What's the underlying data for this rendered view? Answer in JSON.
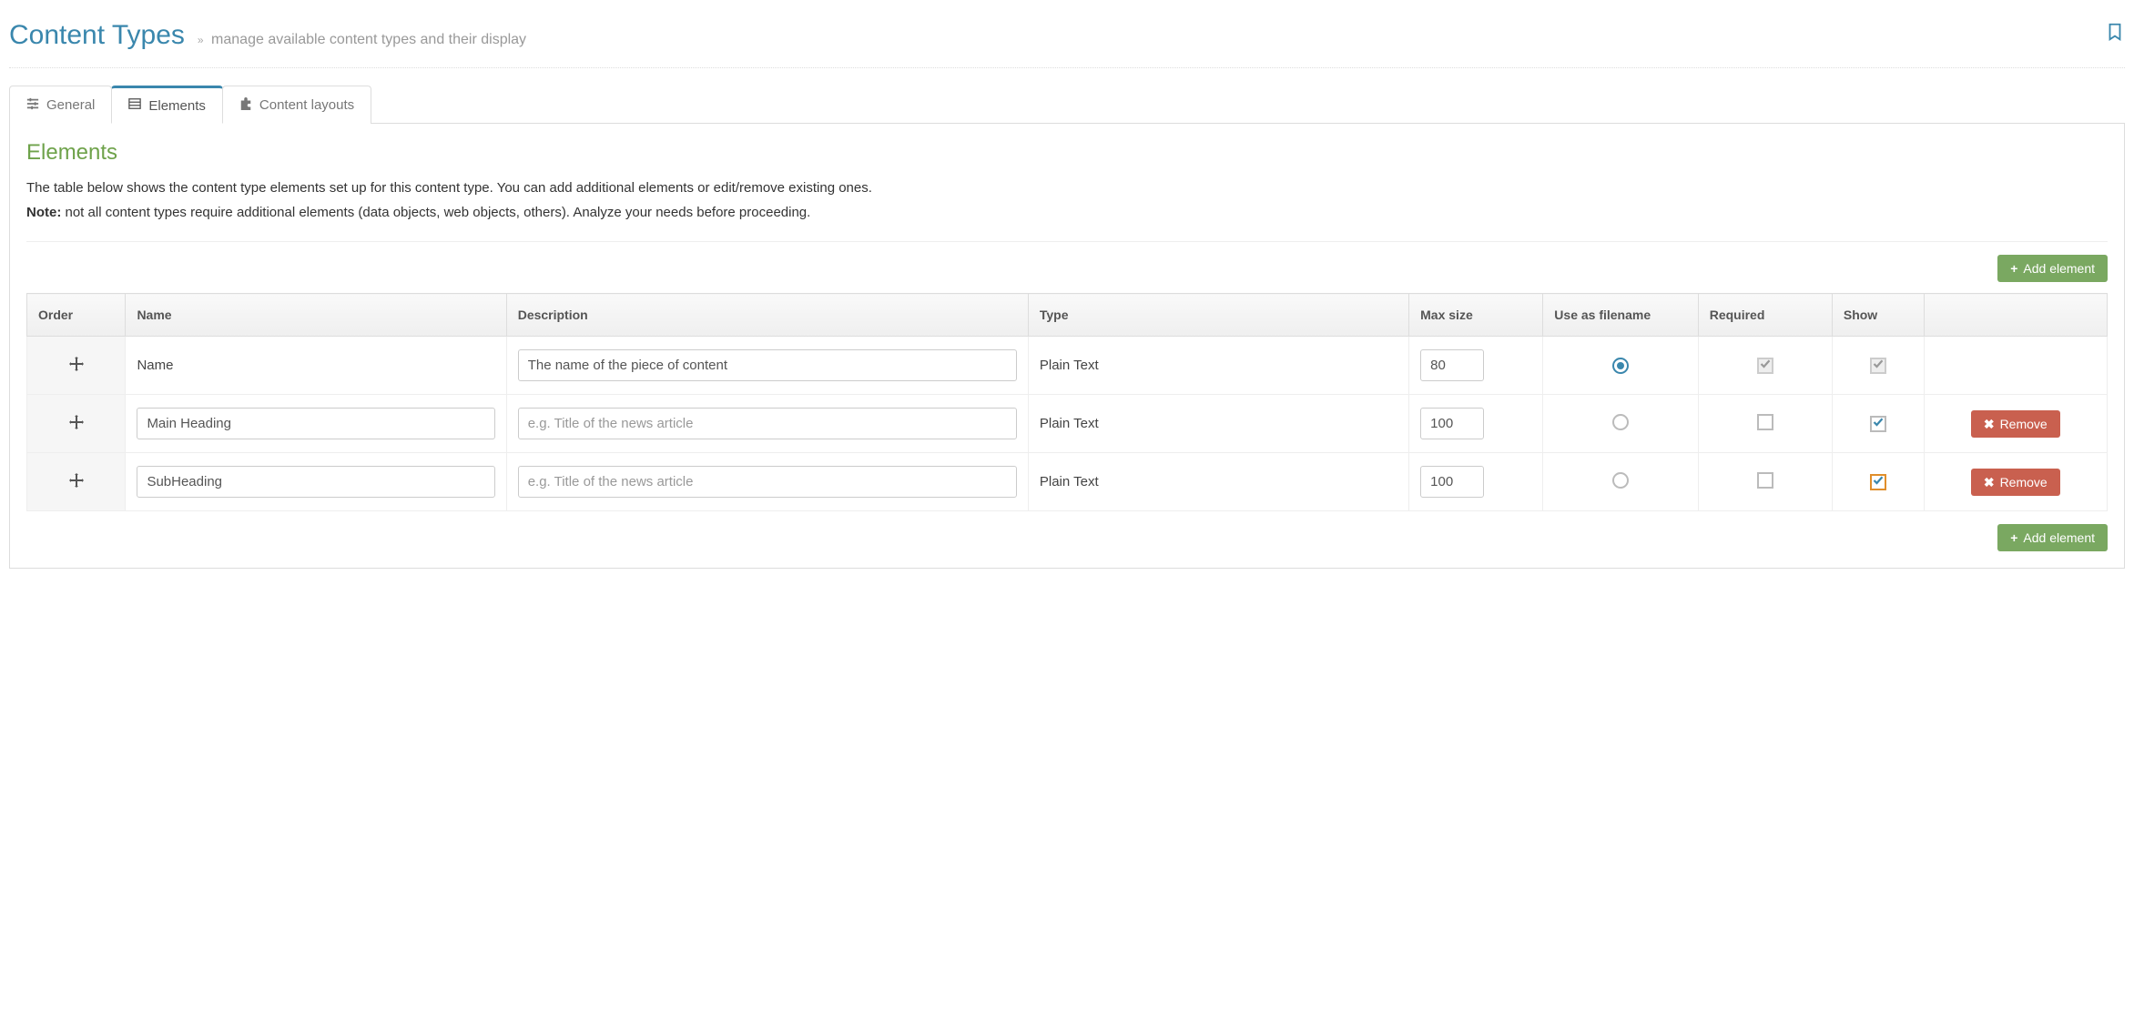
{
  "header": {
    "title": "Content Types",
    "subtitle": "manage available content types and their display"
  },
  "tabs": [
    {
      "label": "General",
      "active": false
    },
    {
      "label": "Elements",
      "active": true
    },
    {
      "label": "Content layouts",
      "active": false
    }
  ],
  "section": {
    "title": "Elements",
    "intro_line1": "The table below shows the content type elements set up for this content type. You can add additional elements or edit/remove existing ones.",
    "note_label": "Note:",
    "intro_line2": " not all content types require additional elements (data objects, web objects, others). Analyze your needs before proceeding."
  },
  "buttons": {
    "add_element": "Add element",
    "remove": "Remove"
  },
  "table": {
    "headers": {
      "order": "Order",
      "name": "Name",
      "description": "Description",
      "type": "Type",
      "max_size": "Max size",
      "use_as_filename": "Use as filename",
      "required": "Required",
      "show": "Show"
    },
    "placeholder_desc": "e.g. Title of the news article",
    "rows": [
      {
        "name_static": "Name",
        "name_value": "",
        "name_editable": false,
        "desc_value": "The name of the piece of content",
        "type": "Plain Text",
        "max_size": "80",
        "use_as_filename": true,
        "required_checked": true,
        "required_disabled": true,
        "show_checked": true,
        "show_disabled": true,
        "show_focused": false,
        "removable": false
      },
      {
        "name_static": "",
        "name_value": "Main Heading",
        "name_editable": true,
        "desc_value": "",
        "type": "Plain Text",
        "max_size": "100",
        "use_as_filename": false,
        "required_checked": false,
        "required_disabled": false,
        "show_checked": true,
        "show_disabled": false,
        "show_focused": false,
        "removable": true
      },
      {
        "name_static": "",
        "name_value": "SubHeading",
        "name_editable": true,
        "desc_value": "",
        "type": "Plain Text",
        "max_size": "100",
        "use_as_filename": false,
        "required_checked": false,
        "required_disabled": false,
        "show_checked": true,
        "show_disabled": false,
        "show_focused": true,
        "removable": true
      }
    ]
  }
}
